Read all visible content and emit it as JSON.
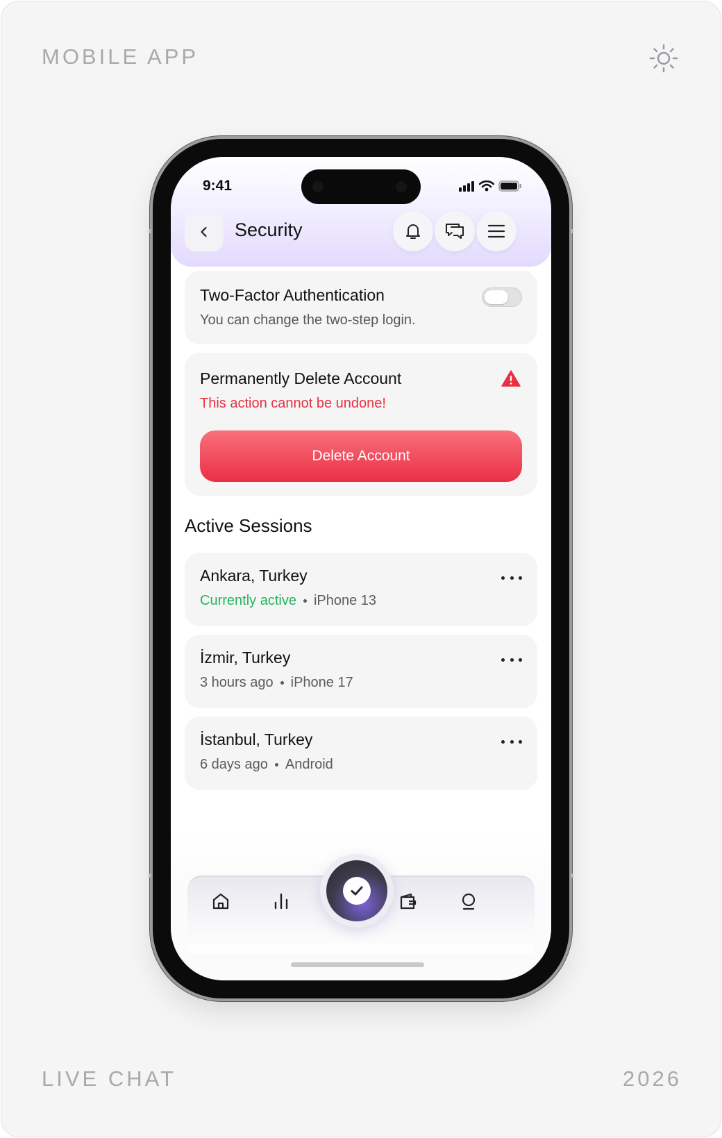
{
  "corners": {
    "top_left": "MOBILE APP",
    "bottom_left": "LIVE CHAT",
    "bottom_right": "2026"
  },
  "status_bar": {
    "time": "9:41"
  },
  "header": {
    "title": "Security"
  },
  "two_factor": {
    "title": "Two-Factor Authentication",
    "subtitle": "You can change the two-step login.",
    "enabled": false
  },
  "delete_account": {
    "title": "Permanently Delete Account",
    "warning": "This action cannot be undone!",
    "button_label": "Delete Account"
  },
  "sessions": {
    "section_title": "Active Sessions",
    "items": [
      {
        "location": "Ankara, Turkey",
        "status": "Currently active",
        "device": "iPhone 13"
      },
      {
        "location": "İzmir, Turkey",
        "status": "3 hours ago",
        "device": "iPhone 17"
      },
      {
        "location": "İstanbul, Turkey",
        "status": "6 days ago",
        "device": "Android"
      }
    ]
  },
  "colors": {
    "accent_purple": "#e2dafd",
    "danger": "#e8303e",
    "active_green": "#22b55c"
  },
  "tabbar": {
    "icons": [
      "home-icon",
      "stats-icon",
      "check-icon",
      "wallet-icon",
      "profile-icon"
    ]
  }
}
